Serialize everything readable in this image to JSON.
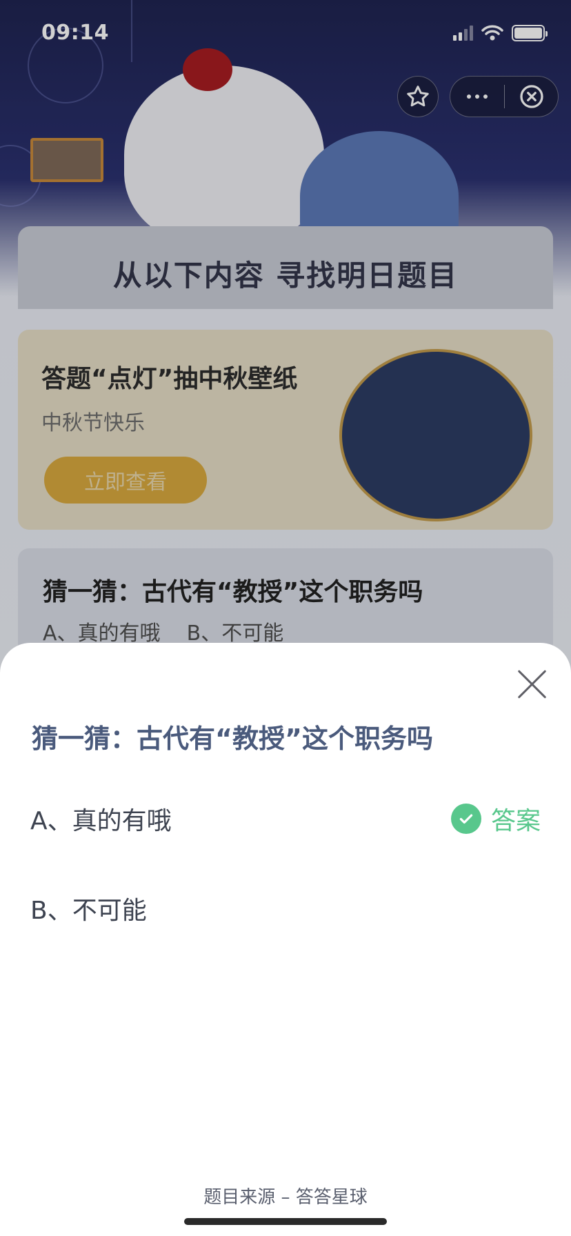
{
  "status_bar": {
    "time": "09:14"
  },
  "background": {
    "banner_title": "从以下内容 寻找明日题目",
    "promo": {
      "title": "答题“点灯”抽中秋壁纸",
      "subtitle": "中秋节快乐",
      "button_label": "立即查看"
    },
    "quiz_preview": {
      "question": "猜一猜：古代有“教授”这个职务吗",
      "options_line": "A、真的有哦    B、不可能"
    }
  },
  "sheet": {
    "question": "猜一猜：古代有“教授”这个职务吗",
    "options": [
      {
        "label": "A、真的有哦",
        "is_answer": true
      },
      {
        "label": "B、不可能",
        "is_answer": false
      }
    ],
    "answer_label": "答案",
    "footer": "题目来源 – 答答星球"
  },
  "colors": {
    "answer_green": "#58c78c",
    "question_text": "#4a5a7c",
    "promo_button": "#d8a93f"
  }
}
